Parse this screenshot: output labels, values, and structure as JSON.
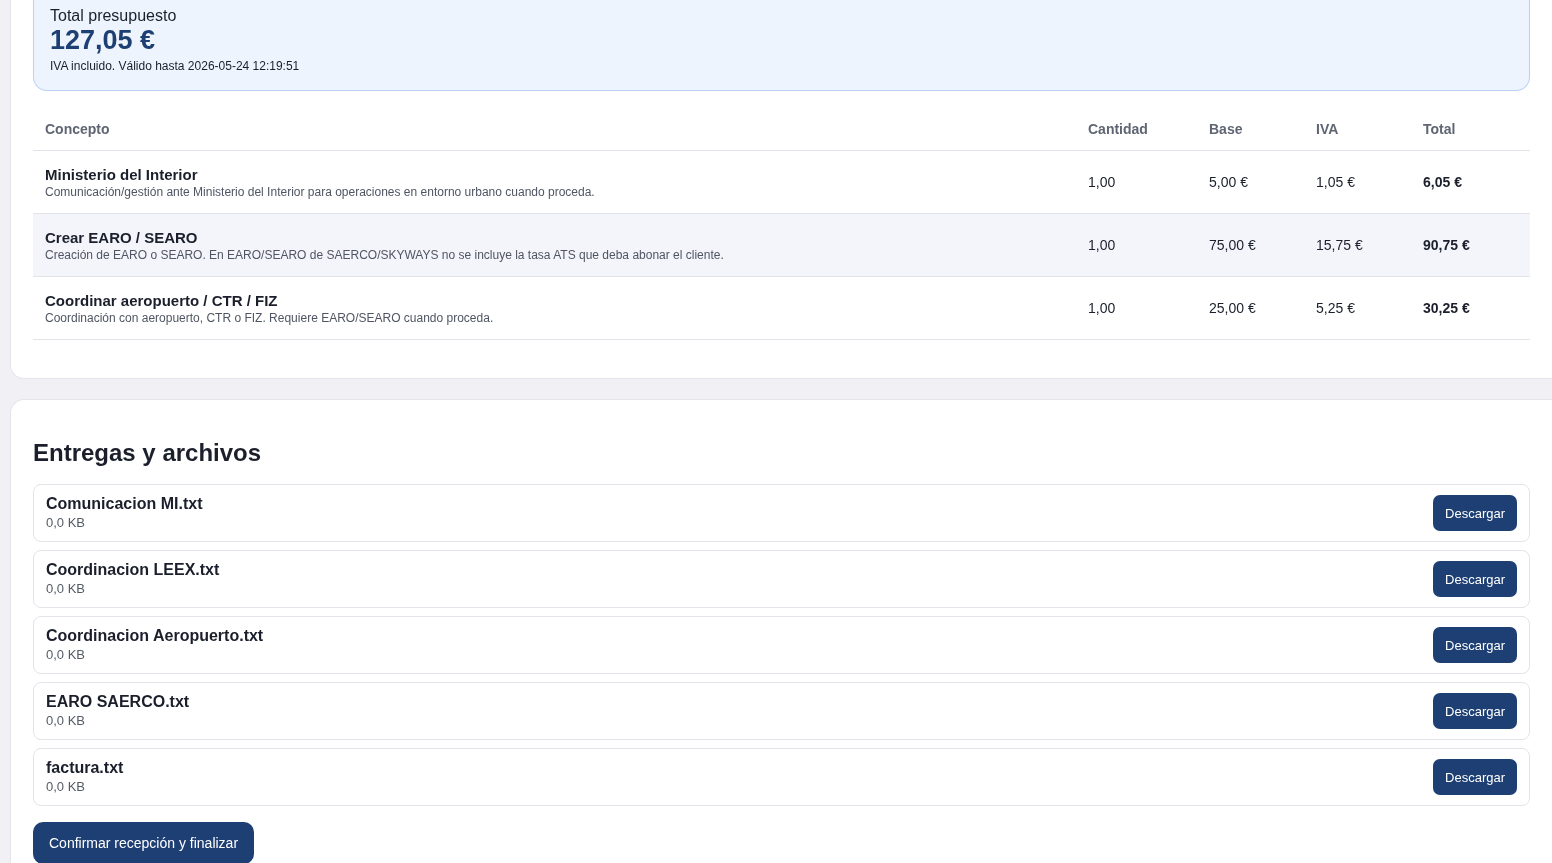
{
  "summary": {
    "label": "Total presupuesto",
    "amount": "127,05 €",
    "note": "IVA incluido. Válido hasta 2026-05-24 12:19:51"
  },
  "table": {
    "columns": [
      "Concepto",
      "Cantidad",
      "Base",
      "IVA",
      "Total"
    ],
    "rows": [
      {
        "title": "Ministerio del Interior",
        "description": "Comunicación/gestión ante Ministerio del Interior para operaciones en entorno urbano cuando proceda.",
        "cantidad": "1,00",
        "base": "5,00 €",
        "iva": "1,05 €",
        "total": "6,05 €",
        "highlighted": false
      },
      {
        "title": "Crear EARO / SEARO",
        "description": "Creación de EARO o SEARO. En EARO/SEARO de SAERCO/SKYWAYS no se incluye la tasa ATS que deba abonar el cliente.",
        "cantidad": "1,00",
        "base": "75,00 €",
        "iva": "15,75 €",
        "total": "90,75 €",
        "highlighted": true
      },
      {
        "title": "Coordinar aeropuerto / CTR / FIZ",
        "description": "Coordinación con aeropuerto, CTR o FIZ. Requiere EARO/SEARO cuando proceda.",
        "cantidad": "1,00",
        "base": "25,00 €",
        "iva": "5,25 €",
        "total": "30,25 €",
        "highlighted": false
      }
    ]
  },
  "files": {
    "title": "Entregas y archivos",
    "items": [
      {
        "name": "Comunicacion MI.txt",
        "size": "0,0 KB",
        "action": "Descargar"
      },
      {
        "name": "Coordinacion LEEX.txt",
        "size": "0,0 KB",
        "action": "Descargar"
      },
      {
        "name": "Coordinacion Aeropuerto.txt",
        "size": "0,0 KB",
        "action": "Descargar"
      },
      {
        "name": "EARO SAERCO.txt",
        "size": "0,0 KB",
        "action": "Descargar"
      },
      {
        "name": "factura.txt",
        "size": "0,0 KB",
        "action": "Descargar"
      }
    ],
    "confirm": "Confirmar recepción y finalizar"
  }
}
